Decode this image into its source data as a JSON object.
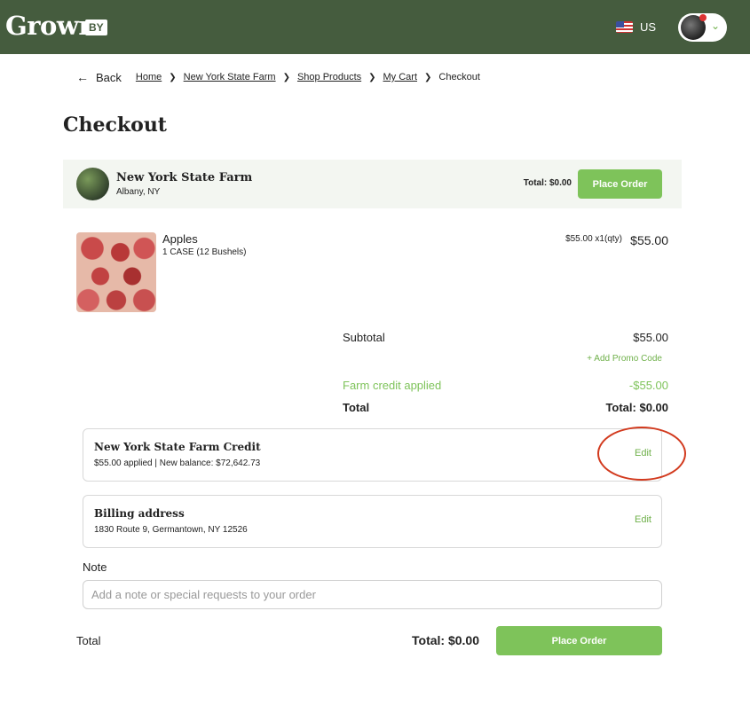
{
  "header": {
    "logo_text": "Grown",
    "logo_suffix": "BY",
    "region": "US",
    "flag_icon": "us-flag-icon"
  },
  "breadcrumb": {
    "back_label": "Back",
    "items": [
      "Home",
      "New York State Farm",
      "Shop Products",
      "My Cart"
    ],
    "current": "Checkout"
  },
  "page_title": "Checkout",
  "farm": {
    "name": "New York State Farm",
    "location": "Albany, NY",
    "total": "Total: $0.00",
    "place_order_label": "Place Order"
  },
  "cart_item": {
    "name": "Apples",
    "variant": "1 CASE (12 Bushels)",
    "unit_qty": "$55.00 x1(qty)",
    "price": "$55.00"
  },
  "summary": {
    "subtotal_label": "Subtotal",
    "subtotal_value": "$55.00",
    "promo_label": "+ Add Promo Code",
    "credit_label": "Farm credit applied",
    "credit_value": "-$55.00",
    "total_label": "Total",
    "total_value": "Total: $0.00"
  },
  "credit_card": {
    "title": "New York State Farm Credit",
    "detail": "$55.00 applied | New balance: $72,642.73",
    "edit_label": "Edit"
  },
  "billing": {
    "title": "Billing address",
    "address": "1830 Route 9, Germantown, NY 12526",
    "edit_label": "Edit"
  },
  "note": {
    "label": "Note",
    "placeholder": "Add a note or special requests to your order",
    "value": ""
  },
  "footer": {
    "total_label": "Total",
    "total_value": "Total: $0.00",
    "place_order_label": "Place Order"
  },
  "colors": {
    "header_bg": "#455c3e",
    "accent_green": "#7ec35a",
    "highlight_red": "#d23a1e"
  }
}
